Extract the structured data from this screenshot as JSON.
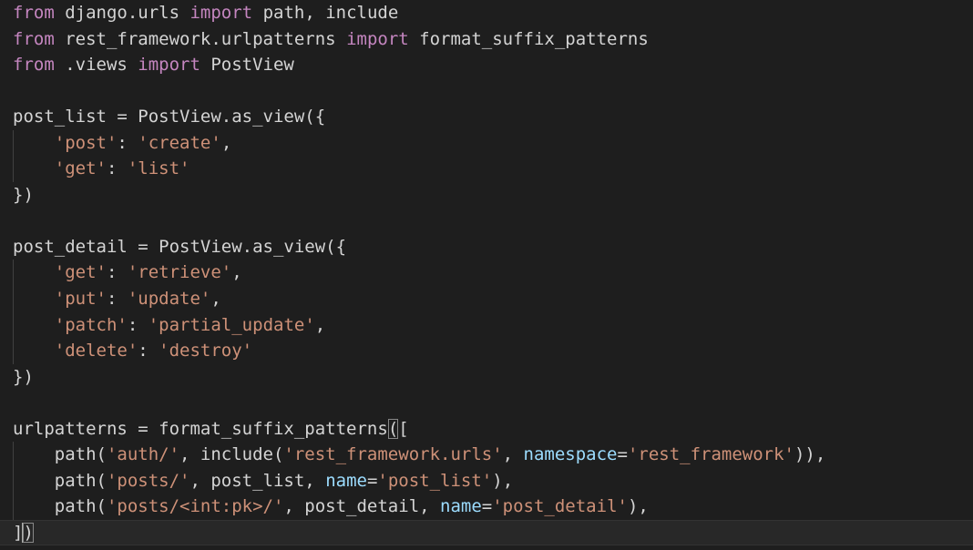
{
  "editor": {
    "language": "python",
    "theme_colors": {
      "background": "#1e1e1e",
      "text": "#d4d4d4",
      "keyword": "#c586c0",
      "string": "#ce9178",
      "parameter": "#9cdcfe",
      "current_line": "#282828"
    },
    "lines": [
      [
        {
          "t": "from",
          "c": "kw"
        },
        {
          "t": " django.urls ",
          "c": "txt"
        },
        {
          "t": "import",
          "c": "kw"
        },
        {
          "t": " path, include",
          "c": "txt"
        }
      ],
      [
        {
          "t": "from",
          "c": "kw"
        },
        {
          "t": " rest_framework.urlpatterns ",
          "c": "txt"
        },
        {
          "t": "import",
          "c": "kw"
        },
        {
          "t": " format_suffix_patterns",
          "c": "txt"
        }
      ],
      [
        {
          "t": "from",
          "c": "kw"
        },
        {
          "t": " .views ",
          "c": "txt"
        },
        {
          "t": "import",
          "c": "kw"
        },
        {
          "t": " PostView",
          "c": "txt"
        }
      ],
      [],
      [
        {
          "t": "post_list = PostView.as_view({",
          "c": "txt"
        }
      ],
      [
        {
          "t": "    ",
          "c": "txt"
        },
        {
          "t": "'post'",
          "c": "str"
        },
        {
          "t": ": ",
          "c": "txt"
        },
        {
          "t": "'create'",
          "c": "str"
        },
        {
          "t": ",",
          "c": "txt"
        }
      ],
      [
        {
          "t": "    ",
          "c": "txt"
        },
        {
          "t": "'get'",
          "c": "str"
        },
        {
          "t": ": ",
          "c": "txt"
        },
        {
          "t": "'list'",
          "c": "str"
        }
      ],
      [
        {
          "t": "})",
          "c": "txt"
        }
      ],
      [],
      [
        {
          "t": "post_detail = PostView.as_view({",
          "c": "txt"
        }
      ],
      [
        {
          "t": "    ",
          "c": "txt"
        },
        {
          "t": "'get'",
          "c": "str"
        },
        {
          "t": ": ",
          "c": "txt"
        },
        {
          "t": "'retrieve'",
          "c": "str"
        },
        {
          "t": ",",
          "c": "txt"
        }
      ],
      [
        {
          "t": "    ",
          "c": "txt"
        },
        {
          "t": "'put'",
          "c": "str"
        },
        {
          "t": ": ",
          "c": "txt"
        },
        {
          "t": "'update'",
          "c": "str"
        },
        {
          "t": ",",
          "c": "txt"
        }
      ],
      [
        {
          "t": "    ",
          "c": "txt"
        },
        {
          "t": "'patch'",
          "c": "str"
        },
        {
          "t": ": ",
          "c": "txt"
        },
        {
          "t": "'partial_update'",
          "c": "str"
        },
        {
          "t": ",",
          "c": "txt"
        }
      ],
      [
        {
          "t": "    ",
          "c": "txt"
        },
        {
          "t": "'delete'",
          "c": "str"
        },
        {
          "t": ": ",
          "c": "txt"
        },
        {
          "t": "'destroy'",
          "c": "str"
        }
      ],
      [
        {
          "t": "})",
          "c": "txt"
        }
      ],
      [],
      [
        {
          "t": "urlpatterns = format_suffix_patterns",
          "c": "txt"
        },
        {
          "t": "(",
          "c": "txt",
          "bm": true
        },
        {
          "t": "[",
          "c": "txt"
        }
      ],
      [
        {
          "t": "    path(",
          "c": "txt"
        },
        {
          "t": "'auth/'",
          "c": "str"
        },
        {
          "t": ", include(",
          "c": "txt"
        },
        {
          "t": "'rest_framework.urls'",
          "c": "str"
        },
        {
          "t": ", ",
          "c": "txt"
        },
        {
          "t": "namespace",
          "c": "param"
        },
        {
          "t": "=",
          "c": "txt"
        },
        {
          "t": "'rest_framework'",
          "c": "str"
        },
        {
          "t": ")),",
          "c": "txt"
        }
      ],
      [
        {
          "t": "    path(",
          "c": "txt"
        },
        {
          "t": "'posts/'",
          "c": "str"
        },
        {
          "t": ", post_list, ",
          "c": "txt"
        },
        {
          "t": "name",
          "c": "param"
        },
        {
          "t": "=",
          "c": "txt"
        },
        {
          "t": "'post_list'",
          "c": "str"
        },
        {
          "t": "),",
          "c": "txt"
        }
      ],
      [
        {
          "t": "    path(",
          "c": "txt"
        },
        {
          "t": "'posts/<int:pk>/'",
          "c": "str"
        },
        {
          "t": ", post_detail, ",
          "c": "txt"
        },
        {
          "t": "name",
          "c": "param"
        },
        {
          "t": "=",
          "c": "txt"
        },
        {
          "t": "'post_detail'",
          "c": "str"
        },
        {
          "t": "),",
          "c": "txt"
        }
      ],
      [
        {
          "t": "]",
          "c": "txt"
        },
        {
          "cursor": true
        },
        {
          "t": ")",
          "c": "txt",
          "bm": true
        }
      ]
    ],
    "current_line_index": 20,
    "indent_guide_lines": [
      5,
      6,
      10,
      11,
      12,
      13,
      17,
      18,
      19
    ]
  }
}
